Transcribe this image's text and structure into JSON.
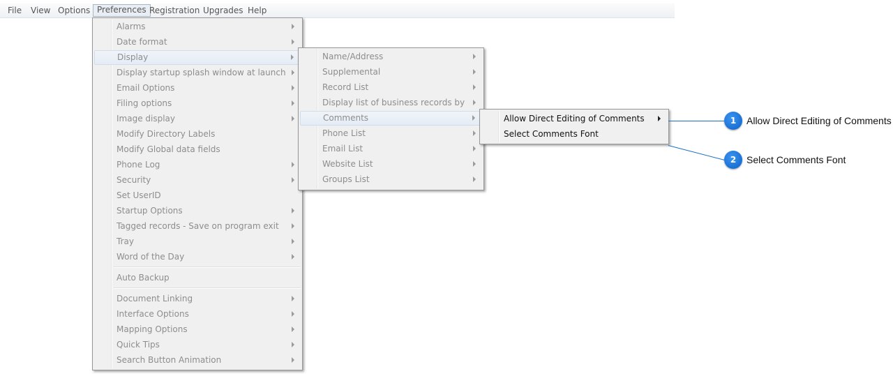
{
  "menubar": {
    "items": [
      "File",
      "View",
      "Options",
      "Preferences",
      "Registration",
      "Upgrades",
      "Help"
    ],
    "active": "Preferences"
  },
  "preferences_menu": {
    "items": [
      {
        "label": "Alarms",
        "submenu": true
      },
      {
        "label": "Date format",
        "submenu": true
      },
      {
        "label": "Display",
        "submenu": true,
        "highlighted": true
      },
      {
        "label": "Display startup splash window at launch",
        "submenu": true
      },
      {
        "label": "Email Options",
        "submenu": true
      },
      {
        "label": "Filing options",
        "submenu": true
      },
      {
        "label": "Image display",
        "submenu": true
      },
      {
        "label": "Modify Directory Labels",
        "submenu": false
      },
      {
        "label": "Modify Global data fields",
        "submenu": false
      },
      {
        "label": "Phone Log",
        "submenu": true
      },
      {
        "label": "Security",
        "submenu": true
      },
      {
        "label": "Set UserID",
        "submenu": false
      },
      {
        "label": "Startup Options",
        "submenu": true
      },
      {
        "label": "Tagged records - Save on program exit",
        "submenu": true
      },
      {
        "label": "Tray",
        "submenu": true
      },
      {
        "label": "Word of the Day",
        "submenu": true
      },
      {
        "label": "Auto Backup",
        "submenu": false
      },
      {
        "label": "Document Linking",
        "submenu": true
      },
      {
        "label": "Interface Options",
        "submenu": true
      },
      {
        "label": "Mapping Options",
        "submenu": true
      },
      {
        "label": "Quick Tips",
        "submenu": true
      },
      {
        "label": "Search Button Animation",
        "submenu": true
      }
    ]
  },
  "display_menu": {
    "items": [
      {
        "label": "Name/Address",
        "submenu": true
      },
      {
        "label": "Supplemental",
        "submenu": true
      },
      {
        "label": "Record List",
        "submenu": true
      },
      {
        "label": "Display list of business records by",
        "submenu": true
      },
      {
        "label": "Comments",
        "submenu": true,
        "highlighted": true
      },
      {
        "label": "Phone List",
        "submenu": true
      },
      {
        "label": "Email List",
        "submenu": true
      },
      {
        "label": "Website List",
        "submenu": true
      },
      {
        "label": "Groups List",
        "submenu": true
      }
    ]
  },
  "comments_menu": {
    "items": [
      {
        "label": "Allow Direct Editing of Comments",
        "submenu": true
      },
      {
        "label": "Select Comments Font",
        "submenu": false
      }
    ]
  },
  "callouts": [
    {
      "number": "1",
      "text": "Allow Direct Editing of Comments"
    },
    {
      "number": "2",
      "text": "Select Comments Font"
    }
  ],
  "colors": {
    "callout_blue": "#0b62c9",
    "menu_bg": "#f0f0f0",
    "disabled_text": "#8d8d8d"
  }
}
